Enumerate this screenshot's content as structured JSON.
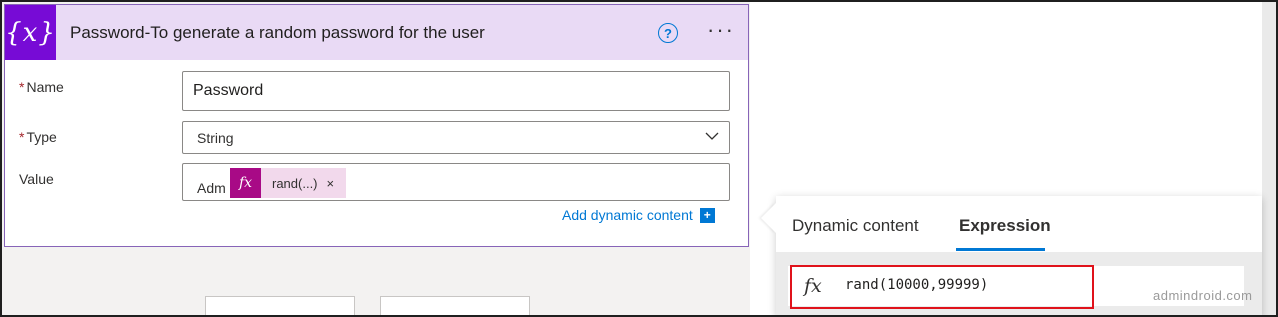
{
  "card": {
    "title": "Password-To generate a random password for the user",
    "icon": "{x}",
    "help_icon": "?",
    "more_icon": "···"
  },
  "fields": {
    "name_label": "Name",
    "name_value": "Password",
    "type_label": "Type",
    "type_value": "String",
    "value_label": "Value",
    "value_prefix": "Adm",
    "token_icon": "fx",
    "token_label": "rand(...)",
    "token_remove": "×",
    "required_mark": "*"
  },
  "add_dynamic": {
    "label": "Add dynamic content",
    "icon": "+"
  },
  "panel": {
    "tabs": [
      {
        "label": "Dynamic content"
      },
      {
        "label": "Expression"
      }
    ],
    "active_tab": "Expression",
    "fx_icon": "fx",
    "expression": "rand(10000,99999)"
  },
  "watermark": "admindroid.com",
  "colors": {
    "accent": "#0078d4",
    "variable_icon": "#770bd6",
    "header_bg": "#e9daf5",
    "token_icon": "#a80a86",
    "highlight": "#e0121b"
  }
}
